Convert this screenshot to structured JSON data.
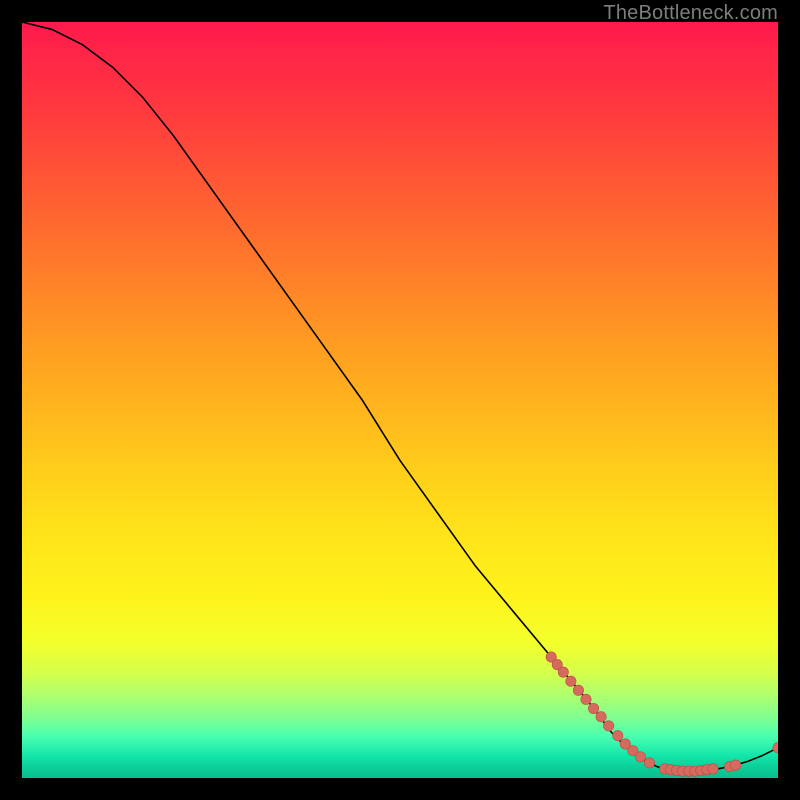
{
  "watermark": "TheBottleneck.com",
  "colors": {
    "black": "#000000",
    "curve": "#000000",
    "point_fill": "#d66a5f",
    "point_stroke": "#b94e45",
    "gradient_top": "#ff1a4d",
    "gradient_bottom": "#09bf8e"
  },
  "chart_data": {
    "type": "line",
    "title": "",
    "xlabel": "",
    "ylabel": "",
    "xlim": [
      0,
      100
    ],
    "ylim": [
      0,
      100
    ],
    "grid": false,
    "legend": false,
    "curve": [
      {
        "x": 0,
        "y": 100
      },
      {
        "x": 4,
        "y": 99
      },
      {
        "x": 8,
        "y": 97
      },
      {
        "x": 12,
        "y": 94
      },
      {
        "x": 16,
        "y": 90
      },
      {
        "x": 20,
        "y": 85
      },
      {
        "x": 25,
        "y": 78
      },
      {
        "x": 30,
        "y": 71
      },
      {
        "x": 35,
        "y": 64
      },
      {
        "x": 40,
        "y": 57
      },
      {
        "x": 45,
        "y": 50
      },
      {
        "x": 50,
        "y": 42
      },
      {
        "x": 55,
        "y": 35
      },
      {
        "x": 60,
        "y": 28
      },
      {
        "x": 65,
        "y": 22
      },
      {
        "x": 70,
        "y": 16
      },
      {
        "x": 75,
        "y": 10
      },
      {
        "x": 78,
        "y": 6
      },
      {
        "x": 80,
        "y": 4
      },
      {
        "x": 82,
        "y": 2.5
      },
      {
        "x": 84,
        "y": 1.5
      },
      {
        "x": 86,
        "y": 1.0
      },
      {
        "x": 88,
        "y": 0.9
      },
      {
        "x": 90,
        "y": 1.0
      },
      {
        "x": 92,
        "y": 1.2
      },
      {
        "x": 94,
        "y": 1.6
      },
      {
        "x": 96,
        "y": 2.2
      },
      {
        "x": 98,
        "y": 3.0
      },
      {
        "x": 100,
        "y": 4.0
      }
    ],
    "series": [
      {
        "name": "highlighted points",
        "style": "scatter",
        "color": "#d66a5f",
        "values": [
          {
            "x": 70.0,
            "y": 16.0
          },
          {
            "x": 70.8,
            "y": 15.0
          },
          {
            "x": 71.6,
            "y": 14.0
          },
          {
            "x": 72.6,
            "y": 12.8
          },
          {
            "x": 73.6,
            "y": 11.6
          },
          {
            "x": 74.6,
            "y": 10.4
          },
          {
            "x": 75.6,
            "y": 9.2
          },
          {
            "x": 76.6,
            "y": 8.1
          },
          {
            "x": 77.6,
            "y": 6.9
          },
          {
            "x": 78.8,
            "y": 5.6
          },
          {
            "x": 79.8,
            "y": 4.5
          },
          {
            "x": 80.8,
            "y": 3.6
          },
          {
            "x": 81.8,
            "y": 2.8
          },
          {
            "x": 83.0,
            "y": 2.0
          },
          {
            "x": 85.0,
            "y": 1.2
          },
          {
            "x": 85.8,
            "y": 1.1
          },
          {
            "x": 86.6,
            "y": 1.0
          },
          {
            "x": 87.4,
            "y": 0.9
          },
          {
            "x": 88.2,
            "y": 0.9
          },
          {
            "x": 89.0,
            "y": 0.9
          },
          {
            "x": 89.8,
            "y": 1.0
          },
          {
            "x": 90.6,
            "y": 1.1
          },
          {
            "x": 91.4,
            "y": 1.2
          },
          {
            "x": 93.6,
            "y": 1.5
          },
          {
            "x": 94.4,
            "y": 1.7
          },
          {
            "x": 100.0,
            "y": 4.0
          }
        ]
      }
    ]
  }
}
